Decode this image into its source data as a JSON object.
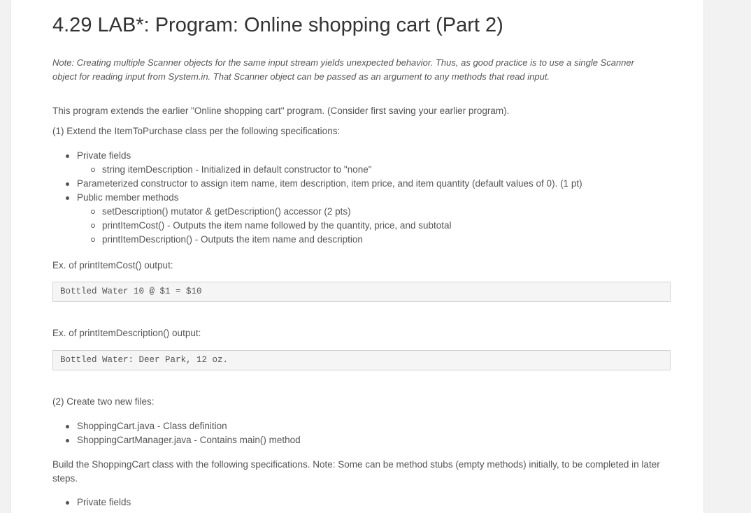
{
  "title": "4.29 LAB*: Program: Online shopping cart (Part 2)",
  "note": "Note: Creating multiple Scanner objects for the same input stream yields unexpected behavior. Thus, as good practice is to use a single Scanner object for reading input from System.in. That Scanner object can be passed as an argument to any methods that read input.",
  "intro": "This program extends the earlier \"Online shopping cart\" program. (Consider first saving your earlier program).",
  "step1": "(1) Extend the ItemToPurchase class per the following specifications:",
  "list1": {
    "private_fields": "Private fields",
    "item_description": "string itemDescription - Initialized in default constructor to \"none\"",
    "parameterized": "Parameterized constructor to assign item name, item description, item price, and item quantity (default values of 0). (1 pt)",
    "public_methods": "Public member methods",
    "set_get": "setDescription() mutator & getDescription() accessor (2 pts)",
    "print_cost": "printItemCost() - Outputs the item name followed by the quantity, price, and subtotal",
    "print_desc": "printItemDescription() - Outputs the item name and description"
  },
  "ex_cost_label": "Ex. of printItemCost() output:",
  "ex_cost_code": "Bottled Water 10 @ $1 = $10",
  "ex_desc_label": "Ex. of printItemDescription() output:",
  "ex_desc_code": "Bottled Water: Deer Park, 12 oz.",
  "step2": "(2) Create two new files:",
  "list2": {
    "file1": "ShoppingCart.java - Class definition",
    "file2": "ShoppingCartManager.java - Contains main() method"
  },
  "build": "Build the ShoppingCart class with the following specifications. Note: Some can be method stubs (empty methods) initially, to be completed in later steps.",
  "list3": {
    "private_fields": "Private fields"
  }
}
